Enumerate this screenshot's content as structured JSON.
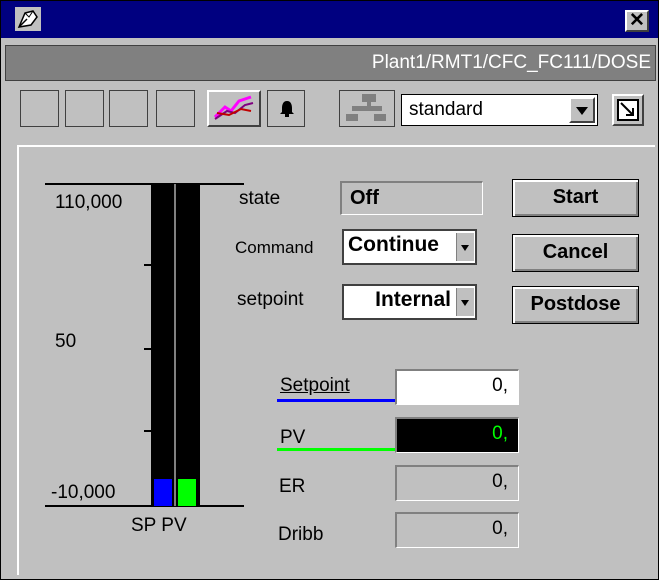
{
  "window": {
    "path": "Plant1/RMT1/CFC_FC111/DOSE",
    "close_glyph": "✕"
  },
  "toolbar": {
    "view_mode": "standard",
    "icons": [
      "trend-icon",
      "bell-icon",
      "network-icon",
      "maximize-icon"
    ]
  },
  "bargraph": {
    "scale_labels": [
      "110,000",
      "50",
      "-10,000"
    ],
    "bar_labels": "SP PV",
    "setpoint_fill": 0,
    "process_value_fill": 0,
    "sp_color": "#0000ff",
    "pv_color": "#00ff00"
  },
  "status": {
    "state_label": "state",
    "state_value": "Off",
    "command_label": "Command",
    "command_value": "Continue",
    "setpoint_label": "setpoint",
    "setpoint_value": "Internal"
  },
  "buttons": {
    "start": "Start",
    "cancel": "Cancel",
    "postdose": "Postdose"
  },
  "values": {
    "setpoint_label": "Setpoint",
    "setpoint_value": "0,",
    "setpoint_color": "#0000ff",
    "pv_label": "PV",
    "pv_value": "0,",
    "pv_color": "#00ff00",
    "er_label": "ER",
    "er_value": "0,",
    "dribb_label": "Dribb",
    "dribb_value": "0,"
  }
}
